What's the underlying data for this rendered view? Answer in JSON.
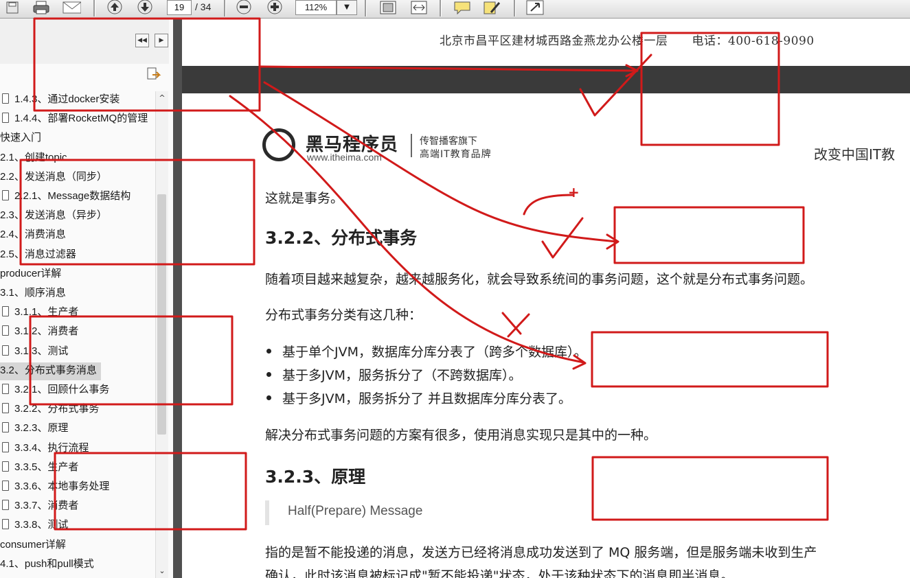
{
  "toolbar": {
    "page_current": "19",
    "page_total": "/ 34",
    "zoom": "112%",
    "icons": [
      "save-icon",
      "print-icon",
      "email-icon",
      "page-up-icon",
      "page-down-icon",
      "zoom-out-icon",
      "zoom-in-icon",
      "fit-page-icon",
      "fit-width-icon",
      "comment-icon",
      "highlight-icon",
      "expand-icon"
    ]
  },
  "sidebar": {
    "bookmarks": [
      {
        "label": "1.4.3、通过docker安装",
        "icon": true
      },
      {
        "label": "1.4.4、部署RocketMQ的管理",
        "icon": true
      },
      {
        "label": "快速入门",
        "icon": false
      },
      {
        "label": "2.1、创建topic",
        "icon": false
      },
      {
        "label": "2.2、发送消息（同步）",
        "icon": false
      },
      {
        "label": "2.2.1、Message数据结构",
        "icon": true
      },
      {
        "label": "2.3、发送消息（异步）",
        "icon": false
      },
      {
        "label": "2.4、消费消息",
        "icon": false
      },
      {
        "label": "2.5、消息过滤器",
        "icon": false
      },
      {
        "label": "producer详解",
        "icon": false
      },
      {
        "label": "3.1、顺序消息",
        "icon": false
      },
      {
        "label": "3.1.1、生产者",
        "icon": true
      },
      {
        "label": "3.1.2、消费者",
        "icon": true
      },
      {
        "label": "3.1.3、测试",
        "icon": true
      },
      {
        "label": "3.2、分布式事务消息",
        "icon": false,
        "selected": true
      },
      {
        "label": "3.2.1、回顾什么事务",
        "icon": true
      },
      {
        "label": "3.2.2、分布式事务",
        "icon": true
      },
      {
        "label": "3.2.3、原理",
        "icon": true
      },
      {
        "label": "3.3.4、执行流程",
        "icon": true
      },
      {
        "label": "3.3.5、生产者",
        "icon": true
      },
      {
        "label": "3.3.6、本地事务处理",
        "icon": true
      },
      {
        "label": "3.3.7、消费者",
        "icon": true
      },
      {
        "label": "3.3.8、测试",
        "icon": true
      },
      {
        "label": "consumer详解",
        "icon": false
      },
      {
        "label": "4.1、push和pull模式",
        "icon": false
      }
    ]
  },
  "doc": {
    "header_address": "北京市昌平区建材城西路金燕龙办公楼一层　　电话：400-618-9090",
    "logo_name": "黑马程序员",
    "logo_url": "www.itheima.com",
    "logo_tag_line1": "传智播客旗下",
    "logo_tag_line2": "高端IT教育品牌",
    "slogan": "改变中国IT教",
    "para_intro": "这就是事务。",
    "heading_322": "3.2.2、分布式事务",
    "para_complex": "随着项目越来越复杂，越来越服务化，就会导致系统间的事务问题，这个就是分布式事务问题。",
    "para_types": "分布式事务分类有这几种：",
    "bullets": [
      "基于单个JVM，数据库分库分表了（跨多个数据库）。",
      "基于多JVM，服务拆分了（不跨数据库）。",
      "基于多JVM，服务拆分了 并且数据库分库分表了。"
    ],
    "para_solution": "解决分布式事务问题的方案有很多，使用消息实现只是其中的一种。",
    "heading_323": "3.2.3、原理",
    "quote": "Half(Prepare) Message",
    "para_half_1": "指的是暂不能投递的消息，发送方已经将消息成功发送到了 MQ 服务端，但是服务端未收到生产",
    "para_half_2": "确认，此时该消息被标记成\"暂不能投递\"状态，处于该种状态下的消息即半消息。"
  },
  "annotation": {
    "color": "#d11a1a",
    "plus_mark": "+"
  }
}
